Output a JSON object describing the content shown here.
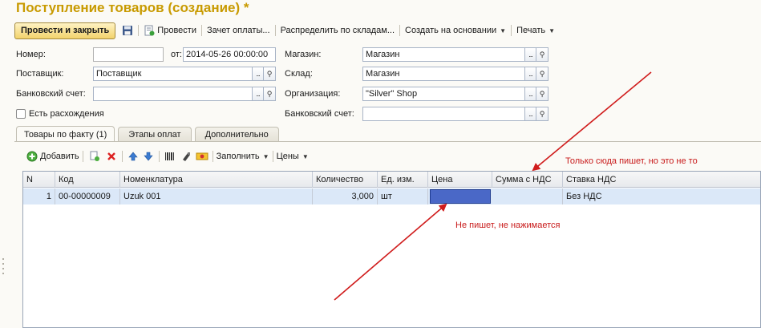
{
  "window": {
    "title": "Поступление товаров (создание) *"
  },
  "toolbar": {
    "post_close": "Провести и закрыть",
    "post": "Провести",
    "payment_offset": "Зачет оплаты...",
    "distribute": "Распределить по складам...",
    "create_based": "Создать на основании",
    "print": "Печать"
  },
  "form": {
    "number_label": "Номер:",
    "number_value": "",
    "from_label": "от:",
    "date_value": "2014-05-26 00:00:00",
    "supplier_label": "Поставщик:",
    "supplier_value": "Поставщик",
    "bank_label": "Банковский счет:",
    "bank_value": "",
    "discrepancy_label": "Есть расхождения",
    "store_label": "Магазин:",
    "store_value": "Магазин",
    "warehouse_label": "Склад:",
    "warehouse_value": "Магазин",
    "org_label": "Организация:",
    "org_value": "\"Silver\" Shop",
    "org_bank_label": "Банковский счет:",
    "org_bank_value": ""
  },
  "tabs": [
    {
      "label": "Товары по факту (1)"
    },
    {
      "label": "Этапы оплат"
    },
    {
      "label": "Дополнительно"
    }
  ],
  "table_toolbar": {
    "add": "Добавить",
    "fill": "Заполнить",
    "prices": "Цены"
  },
  "table": {
    "headers": [
      "N",
      "Код",
      "Номенклатура",
      "Количество",
      "Ед. изм.",
      "Цена",
      "Сумма с НДС",
      "Ставка НДС"
    ],
    "rows": [
      [
        "1",
        "00-00000009",
        "Uzuk 001",
        "3,000",
        "шт",
        "",
        "",
        "Без НДС"
      ]
    ]
  },
  "annotations": {
    "note_top": "Только сюда пишет, но это не то",
    "note_bottom": "Не пишет, не нажимается",
    "color": "#c81a1a"
  },
  "colors": {
    "title": "#c89a00",
    "selection": "#4a68c7",
    "row_highlight": "#dbe8f8"
  }
}
